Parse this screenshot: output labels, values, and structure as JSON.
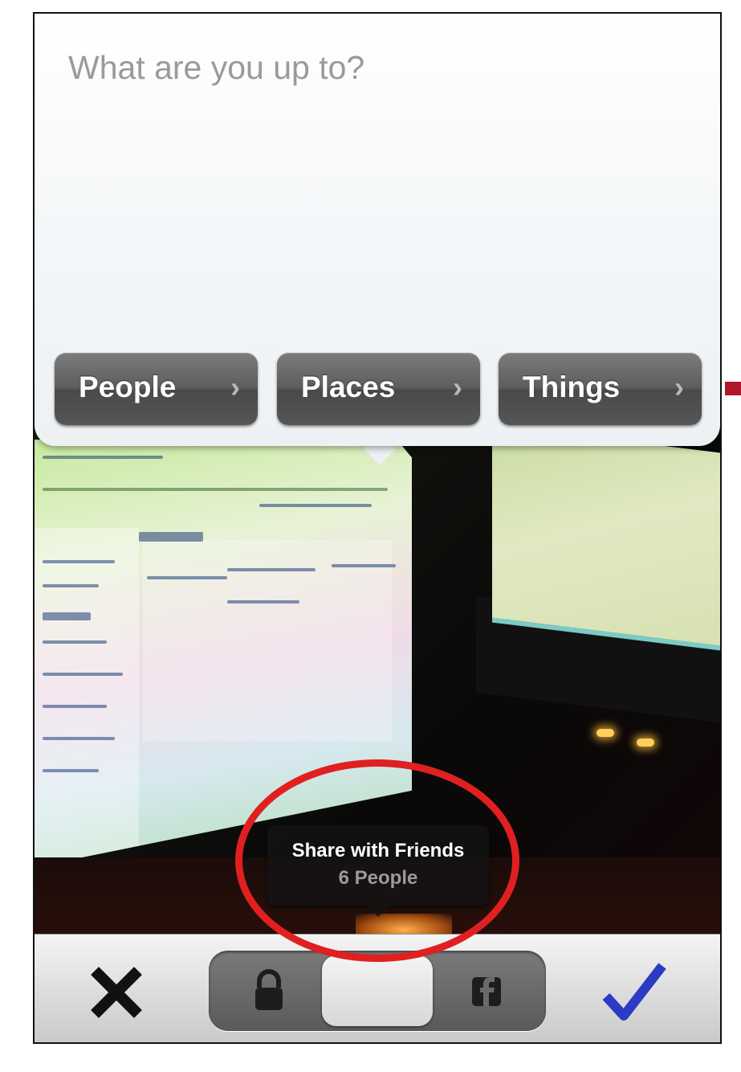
{
  "composer": {
    "placeholder": "What are you up to?"
  },
  "tags": [
    {
      "label": "People",
      "chevron": "›"
    },
    {
      "label": "Places",
      "chevron": "›"
    },
    {
      "label": "Things",
      "chevron": "›"
    }
  ],
  "share_tooltip": {
    "title": "Share with Friends",
    "subtitle": "6 People"
  },
  "toolbar": {
    "cancel_icon": "close-icon",
    "confirm_icon": "checkmark-icon",
    "privacy_segments": [
      {
        "icon": "lock-icon",
        "selected": false
      },
      {
        "icon": "friends-segment",
        "selected": true
      },
      {
        "icon": "facebook-icon",
        "selected": false
      }
    ]
  },
  "colors": {
    "chip": "#5d5d5d",
    "check": "#2a3bc4",
    "annotation": "#e02020"
  }
}
